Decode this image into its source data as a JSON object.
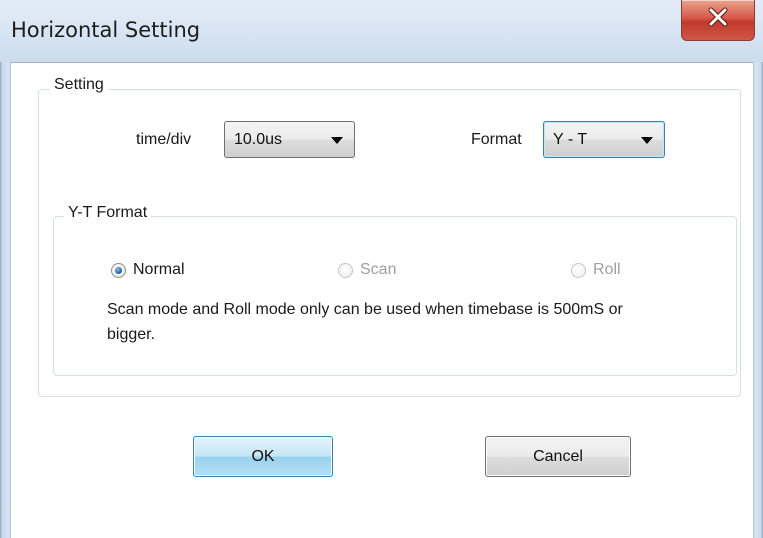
{
  "window": {
    "title": "Horizontal Setting",
    "close_icon": "close-x-icon"
  },
  "setting_group": {
    "label": "Setting",
    "time_div": {
      "label": "time/div",
      "value": "10.0us"
    },
    "format": {
      "label": "Format",
      "value": "Y - T"
    }
  },
  "yt_group": {
    "label": "Y-T Format",
    "options": [
      {
        "label": "Normal",
        "selected": true,
        "enabled": true
      },
      {
        "label": "Scan",
        "selected": false,
        "enabled": false
      },
      {
        "label": "Roll",
        "selected": false,
        "enabled": false
      }
    ],
    "note": "Scan mode and Roll mode only can be used when timebase is 500mS or bigger."
  },
  "buttons": {
    "ok": "OK",
    "cancel": "Cancel"
  },
  "colors": {
    "title_bar": "#d7e4f2",
    "close_button": "#c94534",
    "focus_border": "#3c7fb1",
    "disabled_text": "#a0a0a0"
  }
}
